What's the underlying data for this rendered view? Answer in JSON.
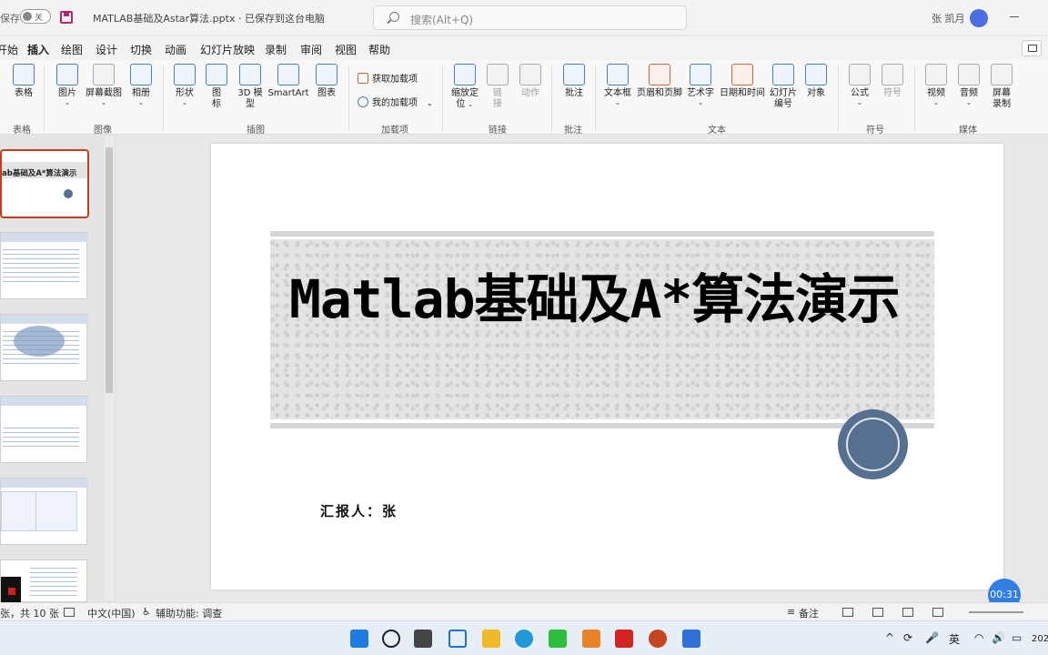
{
  "titlebar": {
    "autosave_label": "保存",
    "autosave_state": "关",
    "doc_title": "MATLAB基础及Astar算法.pptx · 已保存到这台电脑",
    "search_placeholder": "搜索(Alt+Q)",
    "user_name": "张 凯月"
  },
  "tabs": [
    "开始",
    "插入",
    "绘图",
    "设计",
    "切换",
    "动画",
    "幻灯片放映",
    "录制",
    "审阅",
    "视图",
    "帮助"
  ],
  "active_tab": "插入",
  "ribbon": {
    "table": {
      "label": "表格",
      "group": "表格"
    },
    "images": {
      "picture": "图片",
      "screenshot": "屏幕截图",
      "album": "相册",
      "group": "图像"
    },
    "illustrations": {
      "shapes": "形状",
      "icons_1": "图",
      "icons_2": "标",
      "model3d_1": "3D 模",
      "model3d_2": "型",
      "smartart": "SmartArt",
      "chart": "图表",
      "group": "插图"
    },
    "addins": {
      "get": "获取加载项",
      "mine": "我的加载项",
      "group": "加载项"
    },
    "links": {
      "zoom_1": "缩放定",
      "zoom_2": "位",
      "link_1": "链",
      "link_2": "接",
      "action": "动作",
      "group": "链接"
    },
    "comments": {
      "comment": "批注",
      "group": "批注"
    },
    "text": {
      "textbox": "文本框",
      "header_footer": "页眉和页脚",
      "wordart": "艺术字",
      "datetime": "日期和时间",
      "slide_no_1": "幻灯片",
      "slide_no_2": "编号",
      "object": "对象",
      "group": "文本"
    },
    "symbols": {
      "equation": "公式",
      "symbol": "符号",
      "group": "符号"
    },
    "media": {
      "video": "视频",
      "audio": "音频",
      "screen_rec_1": "屏幕",
      "screen_rec_2": "录制",
      "group": "媒体"
    }
  },
  "thumbnails": {
    "first_title": "ab基础及A*算法演示"
  },
  "slide": {
    "title": "Matlab基础及A*算法演示",
    "reporter": "汇报人：张"
  },
  "timer": "00:31",
  "statusbar": {
    "slide_count": "张，共 10 张",
    "language": "中文(中国)",
    "accessibility": "辅助功能: 调查",
    "notes": "备注"
  },
  "taskbar": {
    "ime": "英",
    "clock": "202"
  }
}
